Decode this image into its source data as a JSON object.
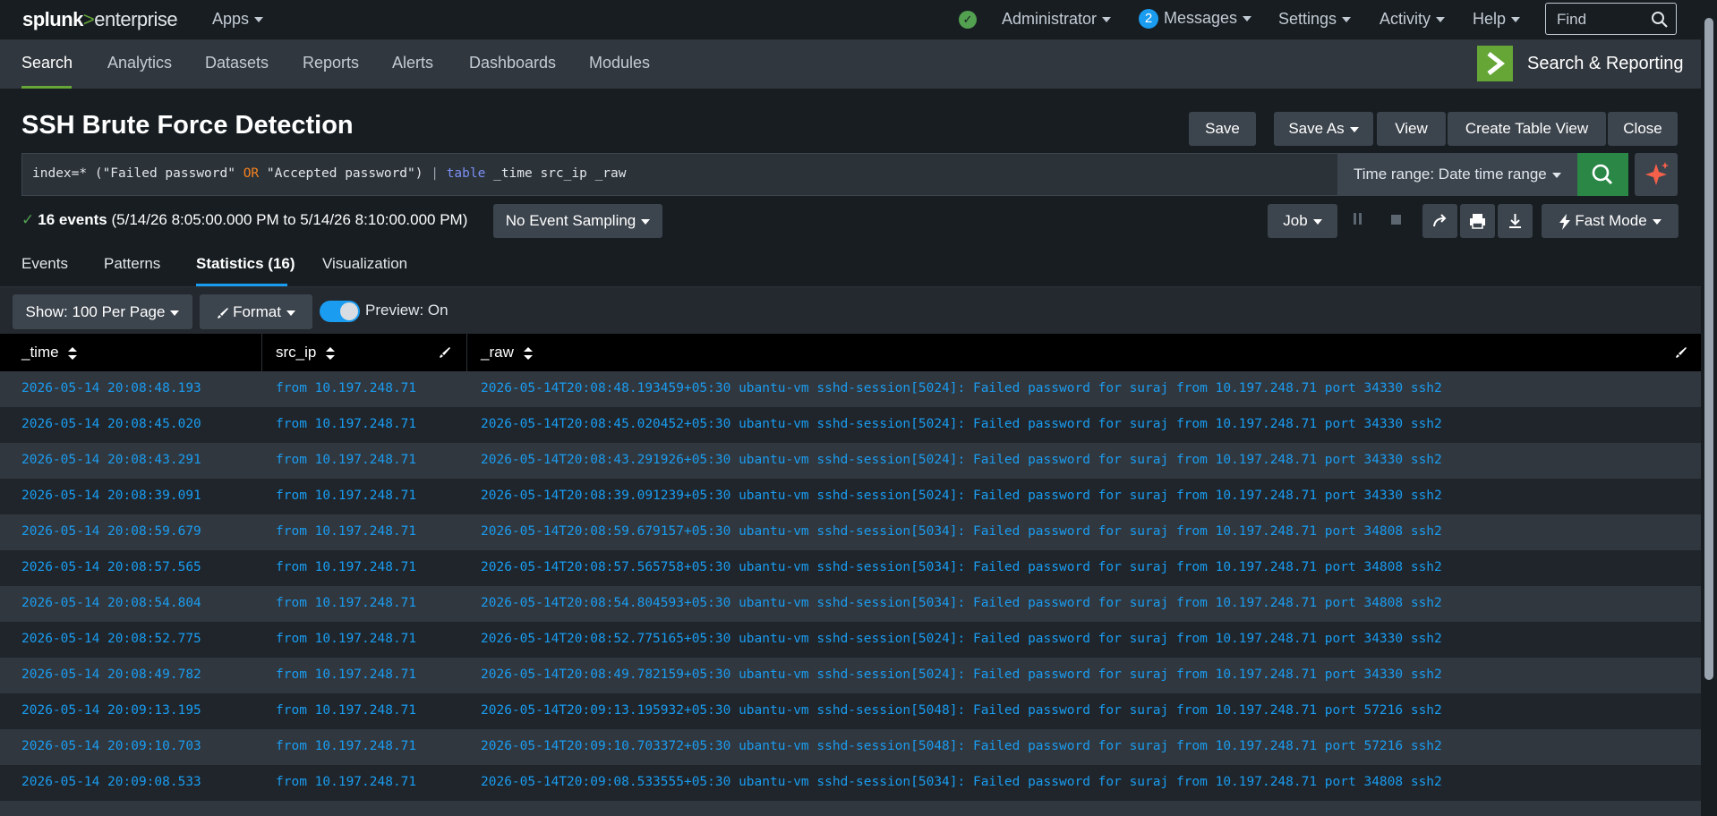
{
  "topbar": {
    "logo_main": "splunk",
    "logo_gt": ">",
    "logo_sub": "enterprise",
    "apps_label": "Apps",
    "status_icon": "check-circle-icon",
    "status_color": "#53a051",
    "user_label": "Administrator",
    "messages_count": "2",
    "messages_label": "Messages",
    "settings_label": "Settings",
    "activity_label": "Activity",
    "help_label": "Help",
    "find_placeholder": "Find"
  },
  "appbar": {
    "nav": [
      "Search",
      "Analytics",
      "Datasets",
      "Reports",
      "Alerts",
      "Dashboards",
      "Modules"
    ],
    "active": "Search",
    "app_title": "Search & Reporting",
    "accent": "#65a637"
  },
  "page": {
    "title": "SSH Brute Force Detection",
    "buttons": {
      "save": "Save",
      "save_as": "Save As",
      "view": "View",
      "create_table_view": "Create Table View",
      "close": "Close"
    }
  },
  "search": {
    "query_part1": "index=* (\"Failed password\" ",
    "query_or": "OR",
    "query_part2": " \"Accepted password\") ",
    "query_pipe": "|",
    "query_cmd": "table",
    "query_part3": " _time src_ip _raw",
    "time_range": "Time range: Date time range"
  },
  "results": {
    "count_label": "16 events",
    "range_label": "(5/14/26 8:05:00.000 PM to 5/14/26 8:10:00.000 PM)",
    "sampling": "No Event Sampling",
    "job": "Job",
    "mode": "Fast Mode"
  },
  "tabs": {
    "events": "Events",
    "patterns": "Patterns",
    "statistics": "Statistics (16)",
    "visualization": "Visualization"
  },
  "toolbar": {
    "show": "Show: 100 Per Page",
    "format": "Format",
    "preview": "Preview: On"
  },
  "table": {
    "columns": [
      "_time",
      "src_ip",
      "_raw"
    ],
    "rows": [
      [
        "2026-05-14 20:08:48.193",
        "from 10.197.248.71",
        "2026-05-14T20:08:48.193459+05:30 ubantu-vm sshd-session[5024]: Failed password for suraj from 10.197.248.71 port 34330 ssh2"
      ],
      [
        "2026-05-14 20:08:45.020",
        "from 10.197.248.71",
        "2026-05-14T20:08:45.020452+05:30 ubantu-vm sshd-session[5024]: Failed password for suraj from 10.197.248.71 port 34330 ssh2"
      ],
      [
        "2026-05-14 20:08:43.291",
        "from 10.197.248.71",
        "2026-05-14T20:08:43.291926+05:30 ubantu-vm sshd-session[5024]: Failed password for suraj from 10.197.248.71 port 34330 ssh2"
      ],
      [
        "2026-05-14 20:08:39.091",
        "from 10.197.248.71",
        "2026-05-14T20:08:39.091239+05:30 ubantu-vm sshd-session[5024]: Failed password for suraj from 10.197.248.71 port 34330 ssh2"
      ],
      [
        "2026-05-14 20:08:59.679",
        "from 10.197.248.71",
        "2026-05-14T20:08:59.679157+05:30 ubantu-vm sshd-session[5034]: Failed password for suraj from 10.197.248.71 port 34808 ssh2"
      ],
      [
        "2026-05-14 20:08:57.565",
        "from 10.197.248.71",
        "2026-05-14T20:08:57.565758+05:30 ubantu-vm sshd-session[5034]: Failed password for suraj from 10.197.248.71 port 34808 ssh2"
      ],
      [
        "2026-05-14 20:08:54.804",
        "from 10.197.248.71",
        "2026-05-14T20:08:54.804593+05:30 ubantu-vm sshd-session[5034]: Failed password for suraj from 10.197.248.71 port 34808 ssh2"
      ],
      [
        "2026-05-14 20:08:52.775",
        "from 10.197.248.71",
        "2026-05-14T20:08:52.775165+05:30 ubantu-vm sshd-session[5024]: Failed password for suraj from 10.197.248.71 port 34330 ssh2"
      ],
      [
        "2026-05-14 20:08:49.782",
        "from 10.197.248.71",
        "2026-05-14T20:08:49.782159+05:30 ubantu-vm sshd-session[5024]: Failed password for suraj from 10.197.248.71 port 34330 ssh2"
      ],
      [
        "2026-05-14 20:09:13.195",
        "from 10.197.248.71",
        "2026-05-14T20:09:13.195932+05:30 ubantu-vm sshd-session[5048]: Failed password for suraj from 10.197.248.71 port 57216 ssh2"
      ],
      [
        "2026-05-14 20:09:10.703",
        "from 10.197.248.71",
        "2026-05-14T20:09:10.703372+05:30 ubantu-vm sshd-session[5048]: Failed password for suraj from 10.197.248.71 port 57216 ssh2"
      ],
      [
        "2026-05-14 20:09:08.533",
        "from 10.197.248.71",
        "2026-05-14T20:09:08.533555+05:30 ubantu-vm sshd-session[5034]: Failed password for suraj from 10.197.248.71 port 34808 ssh2"
      ]
    ]
  }
}
